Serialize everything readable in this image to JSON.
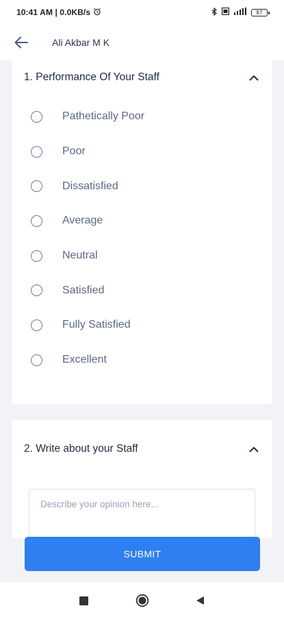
{
  "status_bar": {
    "time_text": "10:41 AM | 0.0KB/s",
    "battery_level": "87",
    "icons": [
      "alarm-icon",
      "bluetooth-icon",
      "sim-icon",
      "signal-icon",
      "battery-icon"
    ]
  },
  "header": {
    "title": "Ali Akbar M K",
    "back_icon": "arrow-left-icon"
  },
  "questions": [
    {
      "title": "1. Performance Of Your Staff",
      "expanded": true,
      "options": [
        {
          "label": "Pathetically Poor",
          "selected": false
        },
        {
          "label": "Poor",
          "selected": false
        },
        {
          "label": "Dissatisfied",
          "selected": false
        },
        {
          "label": "Average",
          "selected": false
        },
        {
          "label": "Neutral",
          "selected": false
        },
        {
          "label": "Satisfied",
          "selected": false
        },
        {
          "label": "Fully Satisfied",
          "selected": false
        },
        {
          "label": "Excellent",
          "selected": false
        }
      ]
    },
    {
      "title": "2. Write about your Staff",
      "expanded": true,
      "placeholder": "Describe your opinion here...",
      "value": ""
    }
  ],
  "submit_label": "SUBMIT",
  "colors": {
    "accent": "#2f7ff0",
    "text_primary": "#1f2a44",
    "text_secondary": "#5d6785",
    "background": "#f2f3f6"
  },
  "nav_bar": {
    "icons": [
      "recents-square-icon",
      "home-circle-icon",
      "back-triangle-icon"
    ]
  }
}
